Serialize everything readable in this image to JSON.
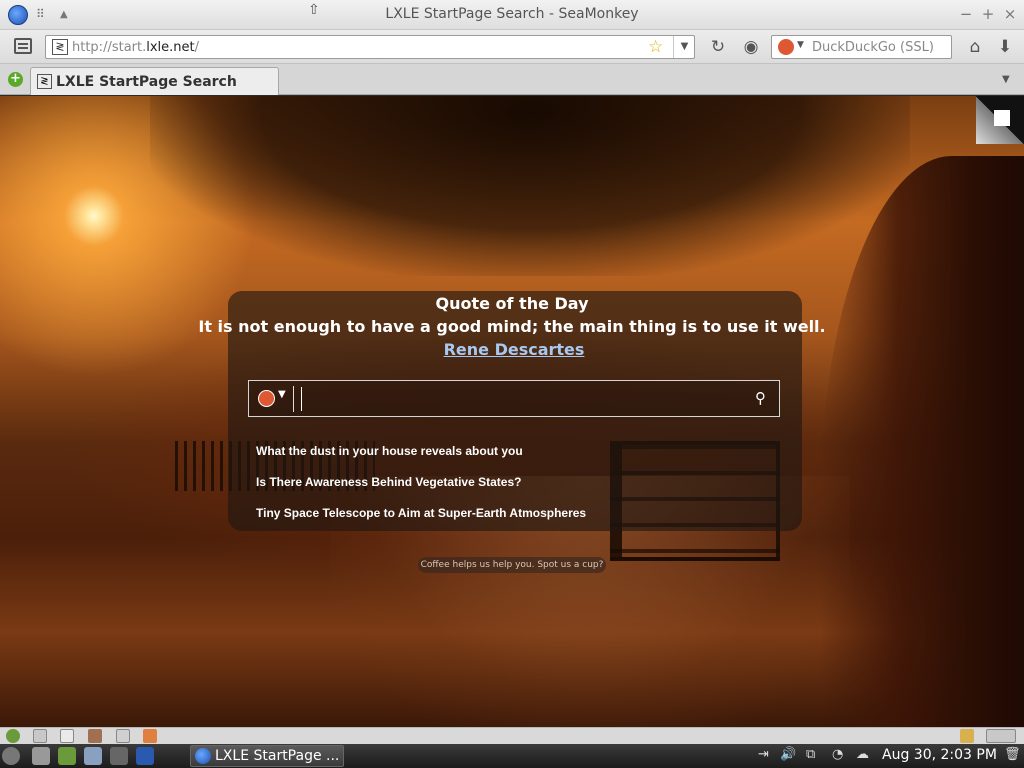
{
  "window": {
    "title": "LXLE StartPage Search - SeaMonkey",
    "minimize_glyph": "−",
    "maximize_glyph": "+",
    "close_glyph": "×"
  },
  "navigation": {
    "url_prefix": "http://start.",
    "url_domain": "lxle.net",
    "url_suffix": "/",
    "search_engine": "DuckDuckGo (SSL)"
  },
  "tabs": [
    {
      "label": "LXLE StartPage Search",
      "active": true
    }
  ],
  "start_page": {
    "quote_heading": "Quote of the Day",
    "quote_text": "It is not enough to have a good mind; the main thing is to use it well.",
    "quote_author": "Rene Descartes",
    "search_placeholder": "",
    "news": [
      "What the dust in your house reveals about you",
      "Is There Awareness Behind Vegetative States?",
      "Tiny Space Telescope to Aim at Super-Earth Atmospheres"
    ],
    "donate_text": "Coffee helps us help you. Spot us a cup?"
  },
  "taskbar": {
    "task_label": "LXLE StartPage ...",
    "clock": "Aug 30,  2:03 PM"
  },
  "colors": {
    "accent_link": "#a8c8f0",
    "ddg_orange": "#de5833",
    "add_tab_green": "#5aaa2a"
  }
}
